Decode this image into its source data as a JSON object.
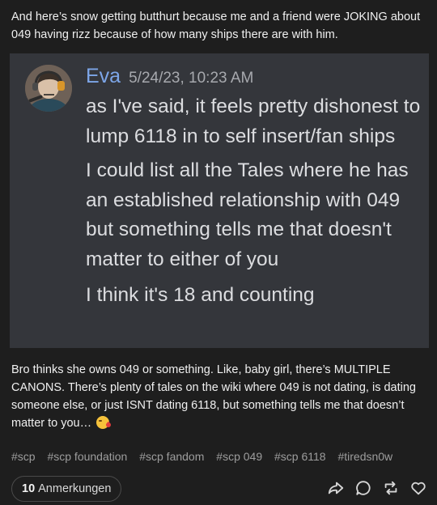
{
  "post": {
    "intro_text": "And here’s snow getting butthurt because me and a friend were JOKING about 049 having rizz because of how many ships there are with him.",
    "commentary_text": "Bro thinks she owns 049 or something. Like, baby girl, there’s MULTIPLE CANONS. There’s plenty of tales on the wiki where 049 is not dating, is dating someone else, or just ISNT dating 6118, but something tells me that doesn’t matter to you…",
    "emoji_name": "face-blowing-a-kiss"
  },
  "screenshot": {
    "author": "Eva",
    "timestamp": "5/24/23, 10:23 AM",
    "messages": [
      "as I've said, it feels pretty dishonest to lump 6118 in to self insert/fan ships",
      "I could list all the Tales where he has an established relationship with 049 but something tells me that doesn't matter to either of you",
      "I think it's 18 and counting"
    ],
    "author_color": "#7da6e8",
    "background_color": "#34363b"
  },
  "tags": [
    "#scp",
    "#scp foundation",
    "#scp fandom",
    "#scp 049",
    "#scp 6118",
    "#tiredsn0w"
  ],
  "footer": {
    "notes_count": "10",
    "notes_label": "Anmerkungen",
    "icons": [
      "share-icon",
      "reply-icon",
      "reblog-icon",
      "like-icon"
    ]
  }
}
